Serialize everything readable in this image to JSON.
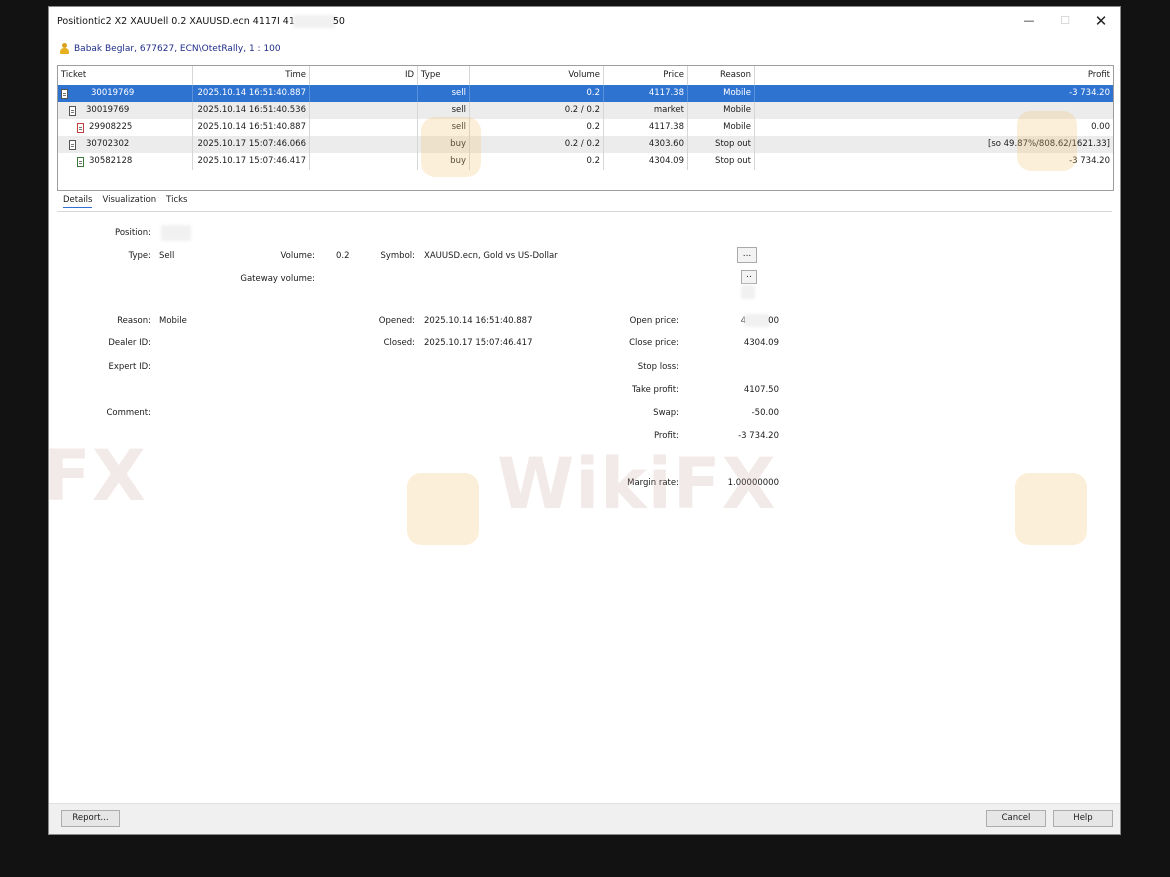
{
  "window": {
    "title": "Positiontic2 X2 XAUUell 0.2 XAUUSD.ecn 4117I 41",
    "title_tail": "50",
    "minimize_icon": "minimize-icon",
    "maximize_icon": "maximize-icon",
    "close_icon": "close-icon"
  },
  "account": {
    "text": "Babak Beglar, 677627, ECN\\OtetRally, 1 : 100"
  },
  "grid": {
    "headers": {
      "ticket": "Ticket",
      "time": "Time",
      "id": "ID",
      "type": "Type",
      "volume": "Volume",
      "price": "Price",
      "reason": "Reason",
      "profit": "Profit"
    },
    "rows": [
      {
        "ticket": "30019769",
        "time": "2025.10.14 16:51:40.887",
        "id": "",
        "type": "sell",
        "volume": "0.2",
        "price": "4117.38",
        "reason": "Mobile",
        "profit": "-3 734.20"
      },
      {
        "ticket": "30019769",
        "time": "2025.10.14 16:51:40.536",
        "id": "",
        "type": "sell",
        "volume": "0.2 / 0.2",
        "price": "market",
        "reason": "Mobile",
        "profit": ""
      },
      {
        "ticket": "29908225",
        "time": "2025.10.14 16:51:40.887",
        "id": "",
        "type": "sell",
        "volume": "0.2",
        "price": "4117.38",
        "reason": "Mobile",
        "profit": "0.00"
      },
      {
        "ticket": "30702302",
        "time": "2025.10.17 15:07:46.066",
        "id": "",
        "type": "buy",
        "volume": "0.2 / 0.2",
        "price": "4303.60",
        "reason": "Stop out",
        "profit": "[so 49.87%/808.62/1621.33]"
      },
      {
        "ticket": "30582128",
        "time": "2025.10.17 15:07:46.417",
        "id": "",
        "type": "buy",
        "volume": "0.2",
        "price": "4304.09",
        "reason": "Stop out",
        "profit": "-3 734.20"
      }
    ]
  },
  "tabs": [
    "Details",
    "Visualization",
    "Ticks"
  ],
  "details": {
    "position_label": "Position:",
    "type_label": "Type:",
    "type_value": "Sell",
    "volume_label": "Volume:",
    "volume_value": "0.2",
    "symbol_label": "Symbol:",
    "symbol_value": "XAUUSD.ecn, Gold vs US-Dollar",
    "symbol_button": "...",
    "gateway_volume_label": "Gateway volume:",
    "gateway_button": "..",
    "reason_label": "Reason:",
    "reason_value": "Mobile",
    "dealer_id_label": "Dealer ID:",
    "expert_id_label": "Expert ID:",
    "comment_label": "Comment:",
    "opened_label": "Opened:",
    "opened_value": "2025.10.14 16:51:40.887",
    "closed_label": "Closed:",
    "closed_value": "2025.10.17 15:07:46.417",
    "open_price_label": "Open price:",
    "open_price_value": "4",
    "open_price_tail": "00",
    "close_price_label": "Close price:",
    "close_price_value": "4304.09",
    "stop_loss_label": "Stop loss:",
    "take_profit_label": "Take profit:",
    "take_profit_value": "4107.50",
    "swap_label": "Swap:",
    "swap_value": "-50.00",
    "profit_label": "Profit:",
    "profit_value": "-3 734.20",
    "margin_rate_label": "Margin rate:",
    "margin_rate_value": "1.00000000"
  },
  "footer": {
    "report": "Report...",
    "cancel": "Cancel",
    "help": "Help"
  },
  "watermark": {
    "text": "WikiFX",
    "fragment": "FX"
  },
  "colors": {
    "selection": "#2f73d1",
    "account_text": "#1f2d8a",
    "backdrop": "#121212"
  }
}
